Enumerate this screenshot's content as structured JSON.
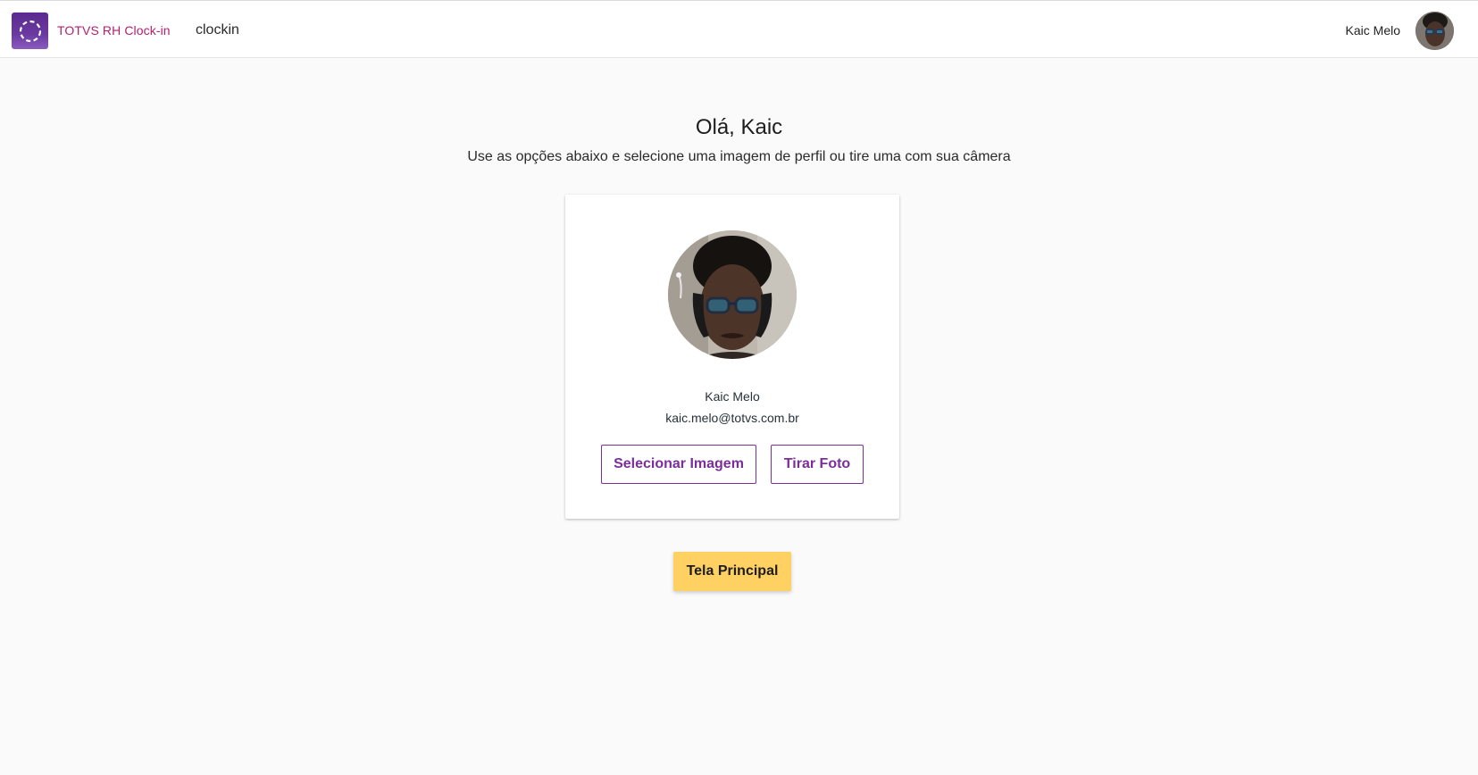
{
  "header": {
    "brand": "TOTVS RH Clock-in",
    "app_name": "clockin",
    "user_name": "Kaic Melo"
  },
  "main": {
    "greeting": "Olá, Kaic",
    "subtitle": "Use as opções abaixo e selecione uma imagem de perfil ou tire uma com sua câmera"
  },
  "profile_card": {
    "name": "Kaic Melo",
    "email": "kaic.melo@totvs.com.br",
    "select_image_label": "Selecionar Imagem",
    "take_photo_label": "Tirar Foto"
  },
  "actions": {
    "main_screen_label": "Tela Principal"
  },
  "colors": {
    "brand_text": "#b41e6e",
    "primary_purple": "#7b2d9c",
    "accent_yellow": "#ffd062",
    "background": "#fafafa"
  },
  "icons": {
    "logo": "dashed-circle-logo-icon"
  }
}
